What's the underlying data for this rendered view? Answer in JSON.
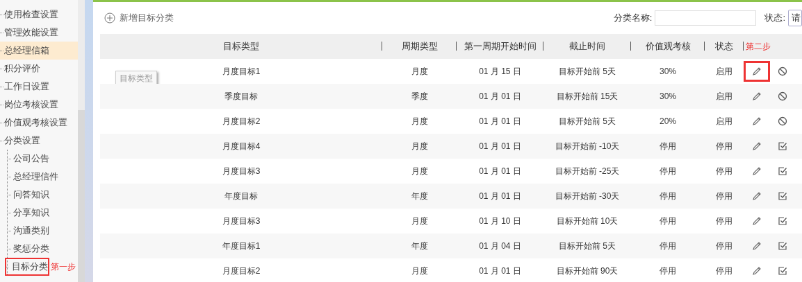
{
  "sidebar": {
    "items": [
      {
        "label": "使用检查设置",
        "selected": false
      },
      {
        "label": "管理效能设置",
        "selected": false
      },
      {
        "label": "总经理信箱",
        "selected": true
      },
      {
        "label": "积分评价",
        "selected": false
      },
      {
        "label": "工作日设置",
        "selected": false
      },
      {
        "label": "岗位考核设置",
        "selected": false
      },
      {
        "label": "价值观考核设置",
        "selected": false
      },
      {
        "label": "分类设置",
        "selected": false,
        "children": [
          {
            "label": "公司公告",
            "selected": false
          },
          {
            "label": "总经理信件",
            "selected": false
          },
          {
            "label": "问答知识",
            "selected": false
          },
          {
            "label": "分享知识",
            "selected": false
          },
          {
            "label": "沟通类别",
            "selected": false
          },
          {
            "label": "奖惩分类",
            "selected": false
          },
          {
            "label": "目标分类",
            "selected": false,
            "highlighted": true,
            "note": "第一步"
          }
        ]
      }
    ]
  },
  "toolbar": {
    "add_button": "新增目标分类",
    "name_filter": {
      "label": "分类名称:"
    },
    "status_filter": {
      "label": "状态:",
      "value": "请"
    }
  },
  "table": {
    "columns": [
      "目标类型",
      "周期类型",
      "第一周期开始时间",
      "截止时间",
      "价值观考核",
      "状态"
    ],
    "action_note": "第二步",
    "tooltip": "目标类型",
    "rows": [
      {
        "cells": [
          "月度目标1",
          "月度",
          "01 月 15 日",
          "目标开始前 5天",
          "30%",
          "启用"
        ],
        "enabled": true,
        "edit_highlighted": true
      },
      {
        "cells": [
          "季度目标",
          "季度",
          "01 月 01 日",
          "目标开始前 15天",
          "30%",
          "启用"
        ],
        "enabled": true,
        "edit_highlighted": false
      },
      {
        "cells": [
          "月度目标2",
          "月度",
          "01 月 01 日",
          "目标开始前 5天",
          "20%",
          "启用"
        ],
        "enabled": true,
        "edit_highlighted": false
      },
      {
        "cells": [
          "月度目标4",
          "月度",
          "01 月 01 日",
          "目标开始前 -10天",
          "停用",
          "停用"
        ],
        "enabled": false,
        "edit_highlighted": false
      },
      {
        "cells": [
          "月度目标3",
          "月度",
          "01 月 01 日",
          "目标开始前 -25天",
          "停用",
          "停用"
        ],
        "enabled": false,
        "edit_highlighted": false
      },
      {
        "cells": [
          "年度目标",
          "年度",
          "01 月 01 日",
          "目标开始前 -30天",
          "停用",
          "停用"
        ],
        "enabled": false,
        "edit_highlighted": false
      },
      {
        "cells": [
          "月度目标3",
          "月度",
          "01 月 10 日",
          "目标开始前 10天",
          "停用",
          "停用"
        ],
        "enabled": false,
        "edit_highlighted": false
      },
      {
        "cells": [
          "年度目标1",
          "年度",
          "01 月 04 日",
          "目标开始前 5天",
          "停用",
          "停用"
        ],
        "enabled": false,
        "edit_highlighted": false
      },
      {
        "cells": [
          "月度目标2",
          "月度",
          "01 月 01 日",
          "目标开始前 90天",
          "停用",
          "停用"
        ],
        "enabled": false,
        "edit_highlighted": false
      }
    ]
  }
}
